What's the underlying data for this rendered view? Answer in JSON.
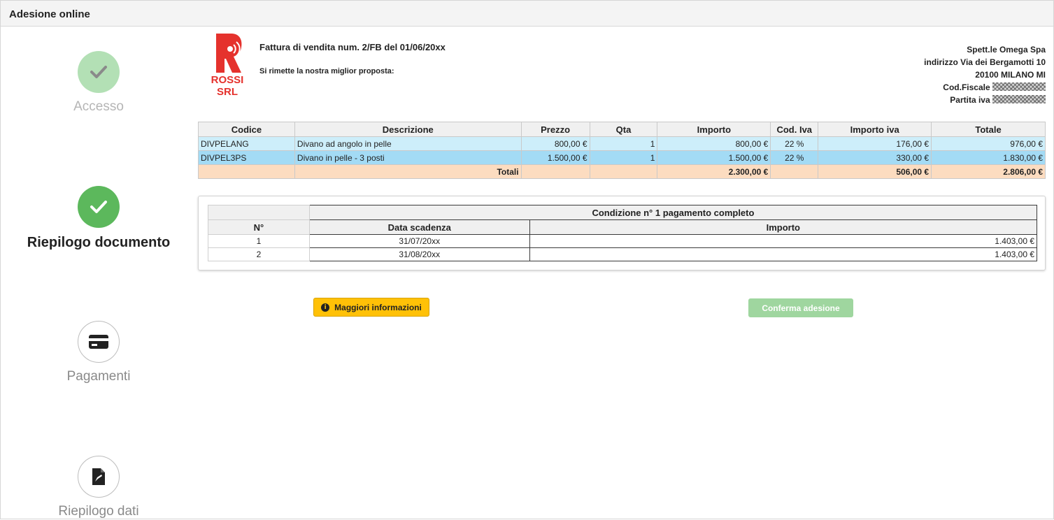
{
  "window": {
    "title": "Adesione online"
  },
  "steps": [
    {
      "label": "Accesso",
      "state": "done",
      "icon": "check-icon"
    },
    {
      "label": "Riepilogo documento",
      "state": "active",
      "icon": "check-icon"
    },
    {
      "label": "Pagamenti",
      "state": "todo",
      "icon": "credit-card-icon"
    },
    {
      "label": "Riepilogo dati",
      "state": "todo",
      "icon": "file-signature-icon"
    }
  ],
  "company": {
    "logo_text": "ROSSI SRL",
    "logo_color": "#e5322d"
  },
  "invoice": {
    "title": "Fattura di vendita num. 2/FB del 01/06/20xx",
    "proposal": "Si rimette la nostra miglior proposta:"
  },
  "recipient": {
    "name": "Spett.le Omega Spa",
    "address": "indirizzo Via dei Bergamotti 10",
    "city": "20100 MILANO MI",
    "cod_fiscale_label": "Cod.Fiscale",
    "partita_iva_label": "Partita iva"
  },
  "items_table": {
    "headers": [
      "Codice",
      "Descrizione",
      "Prezzo",
      "Qta",
      "Importo",
      "Cod. Iva",
      "Importo iva",
      "Totale"
    ],
    "rows": [
      [
        "DIVPELANG",
        "Divano ad angolo in pelle",
        "800,00 €",
        "1",
        "800,00 €",
        "22 %",
        "176,00 €",
        "976,00 €"
      ],
      [
        "DIVPEL3PS",
        "Divano in pelle - 3 posti",
        "1.500,00 €",
        "1",
        "1.500,00 €",
        "22 %",
        "330,00 €",
        "1.830,00 €"
      ]
    ],
    "totals": {
      "label": "Totali",
      "importo": "2.300,00 €",
      "importo_iva": "506,00 €",
      "totale": "2.806,00 €"
    }
  },
  "payment_table": {
    "condition": "Condizione n° 1 pagamento completo",
    "headers": [
      "N°",
      "Data scadenza",
      "Importo"
    ],
    "rows": [
      [
        "1",
        "31/07/20xx",
        "1.403,00 €"
      ],
      [
        "2",
        "31/08/20xx",
        "1.403,00 €"
      ]
    ]
  },
  "buttons": {
    "info": "Maggiori informazioni",
    "info_icon": "info-circle-icon",
    "confirm": "Conferma adesione"
  },
  "colors": {
    "active_step": "#5cb85c",
    "done_step": "#b3e0b5",
    "info_button": "#ffc107",
    "confirm_button": "#9fd69f"
  }
}
